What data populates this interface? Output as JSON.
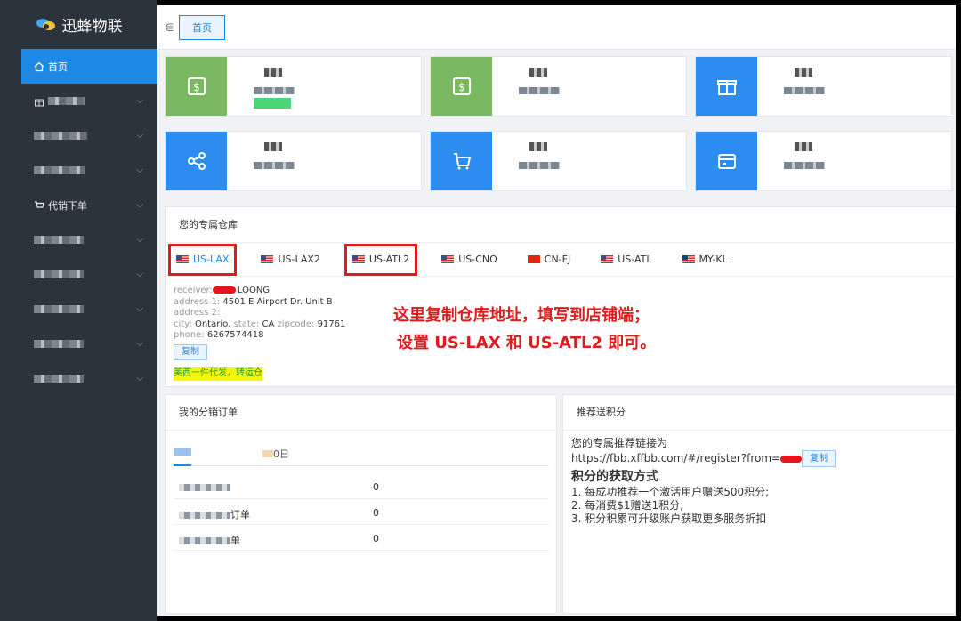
{
  "app": {
    "name": "迅蜂物联"
  },
  "sidebar": {
    "items": [
      {
        "label": "首页",
        "active": true
      },
      {
        "label": "",
        "active": false
      },
      {
        "label": "",
        "active": false
      },
      {
        "label": "",
        "active": false
      },
      {
        "label": "代销下单",
        "active": false
      },
      {
        "label": "",
        "active": false
      },
      {
        "label": "",
        "active": false
      },
      {
        "label": "",
        "active": false
      },
      {
        "label": "",
        "active": false
      },
      {
        "label": "",
        "active": false
      }
    ]
  },
  "topbar": {
    "home_tab": "首页"
  },
  "warehouse": {
    "title": "您的专属仓库",
    "tabs": [
      {
        "label": "US-LAX",
        "flag": "us",
        "highlighted": true,
        "active": true
      },
      {
        "label": "US-LAX2",
        "flag": "us",
        "highlighted": false,
        "active": false
      },
      {
        "label": "US-ATL2",
        "flag": "us",
        "highlighted": true,
        "active": false
      },
      {
        "label": "US-CNO",
        "flag": "us",
        "highlighted": false,
        "active": false
      },
      {
        "label": "CN-FJ",
        "flag": "cn",
        "highlighted": false,
        "active": false
      },
      {
        "label": "US-ATL",
        "flag": "us",
        "highlighted": false,
        "active": false
      },
      {
        "label": "MY-KL",
        "flag": "my",
        "highlighted": false,
        "active": false
      }
    ],
    "address": {
      "receiver_label": "receiver:",
      "receiver_value": "LOONG",
      "address1_label": "address 1:",
      "address1_value": "4501 E Airport Dr. Unit B",
      "address2_label": "address 2:",
      "city_label": "city:",
      "city_value": "Ontario,",
      "state_label": "state:",
      "state_value": "CA",
      "zip_label": "zipcode:",
      "zip_value": "91761",
      "phone_label": "phone:",
      "phone_value": "6267574418"
    },
    "copy_label": "复制",
    "note": "美西一件代发，转运仓",
    "annotation_line1": "这里复制仓库地址，填写到店铺端；",
    "annotation_line2": "设置 US-LAX 和 US-ATL2 即可。"
  },
  "orders": {
    "title": "我的分销订单",
    "tab2_suffix": "0日",
    "rows": [
      {
        "label_suffix": "",
        "value": "0"
      },
      {
        "label_suffix": "订单",
        "value": "0"
      },
      {
        "label_suffix": "单",
        "value": "0"
      }
    ]
  },
  "points": {
    "title": "推荐送积分",
    "link_label": "您的专属推荐链接为",
    "link_url": "https://fbb.xffbb.com/#/register?from=",
    "copy_label": "复制",
    "how_title": "积分的获取方式",
    "rules": [
      "1. 每成功推荐一个激活用户赠送500积分;",
      "2. 每消费$1赠送1积分;",
      "3. 积分积累可升级账户获取更多服务折扣"
    ]
  },
  "colors": {
    "accent": "#1e88e5",
    "green": "#7ab862",
    "blue": "#2d8cf0",
    "annotation": "#e11b1b"
  }
}
